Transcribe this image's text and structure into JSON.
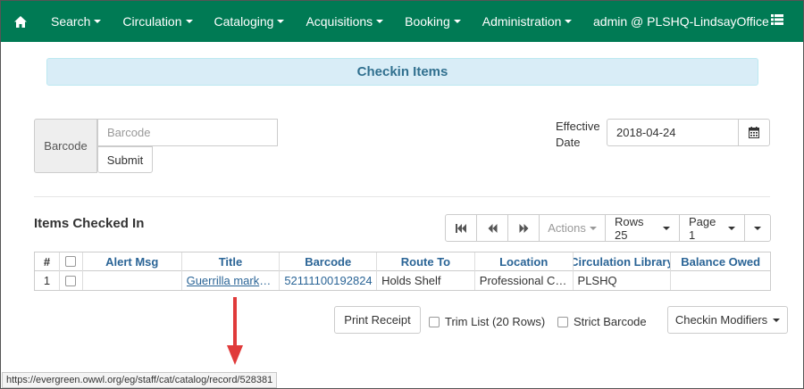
{
  "nav": {
    "items": [
      {
        "label": "Search",
        "name": "nav-search"
      },
      {
        "label": "Circulation",
        "name": "nav-circulation"
      },
      {
        "label": "Cataloging",
        "name": "nav-cataloging"
      },
      {
        "label": "Acquisitions",
        "name": "nav-acquisitions"
      },
      {
        "label": "Booking",
        "name": "nav-booking"
      },
      {
        "label": "Administration",
        "name": "nav-administration"
      }
    ],
    "user": "admin @ PLSHQ-LindsayOffice",
    "home_icon": "home-icon",
    "menu_icon": "list-menu-icon"
  },
  "page": {
    "title": "Checkin Items"
  },
  "form": {
    "barcode_label": "Barcode",
    "barcode_placeholder": "Barcode",
    "submit_label": "Submit",
    "effective_date_label": "Effective Date",
    "effective_date_value": "2018-04-24",
    "calendar_icon": "calendar-icon"
  },
  "grid": {
    "title": "Items Checked In",
    "toolbar": {
      "actions": "Actions",
      "rows": "Rows 25",
      "page": "Page 1"
    },
    "columns": [
      "#",
      "",
      "Alert Msg",
      "Title",
      "Barcode",
      "Route To",
      "Location",
      "Circulation Library",
      "Balance Owed"
    ],
    "rows": [
      {
        "num": "1",
        "alert": "",
        "title": "Guerrilla marketing",
        "barcode": "52111100192824",
        "route_to": "Holds Shelf",
        "location": "Professional Collection",
        "library": "PLSHQ",
        "balance": ""
      }
    ]
  },
  "controls": {
    "print_receipt": "Print Receipt",
    "trim_list": "Trim List (20 Rows)",
    "strict_barcode": "Strict Barcode",
    "checkin_modifiers": "Checkin Modifiers"
  },
  "statusbar": {
    "url": "https://evergreen.owwl.org/eg/staff/cat/catalog/record/528381"
  },
  "colors": {
    "navbar": "#007a54",
    "banner_bg": "#d9edf7",
    "banner_text": "#31708f",
    "link": "#2a6496",
    "arrow": "#e03a3a"
  }
}
